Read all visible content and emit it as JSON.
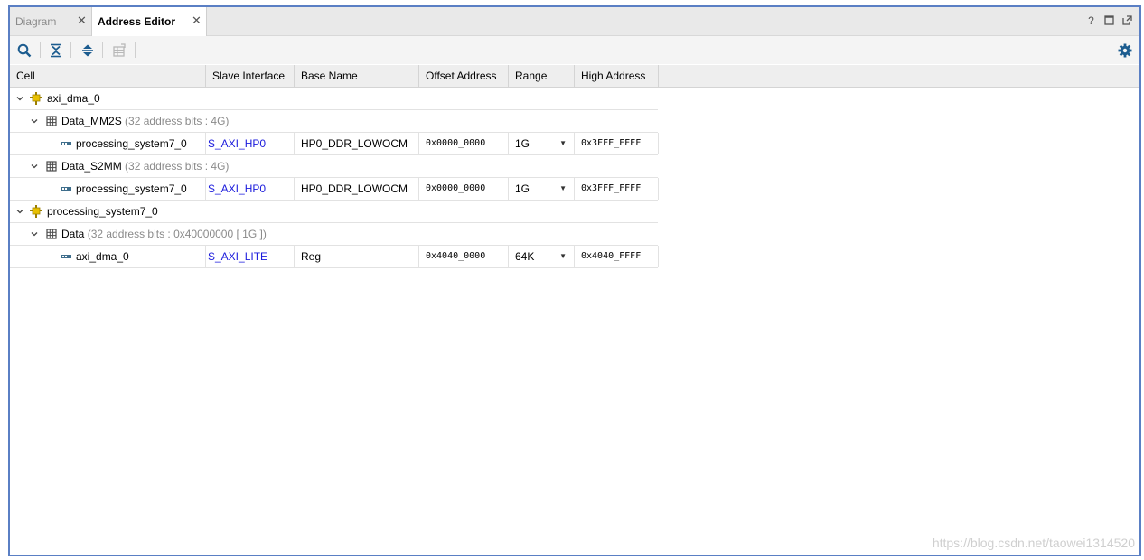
{
  "tabs": [
    {
      "label": "Diagram",
      "active": false
    },
    {
      "label": "Address Editor",
      "active": true
    }
  ],
  "window_icons": [
    "help-icon",
    "maximize-icon",
    "float-icon"
  ],
  "toolbar": {
    "buttons": [
      "search-icon",
      "collapse-all-icon",
      "expand-all-icon",
      "auto-assign-icon"
    ],
    "settings_icon": "gear-icon"
  },
  "columns": [
    "Cell",
    "Slave Interface",
    "Base Name",
    "Offset Address",
    "Range",
    "High Address"
  ],
  "rows": [
    {
      "level": 0,
      "type": "cell",
      "name": "axi_dma_0",
      "detail": ""
    },
    {
      "level": 1,
      "type": "space",
      "name": "Data_MM2S",
      "detail": "(32 address bits : 4G)"
    },
    {
      "level": 2,
      "type": "segment",
      "name": "processing_system7_0",
      "slave_interface": "S_AXI_HP0",
      "base_name": "HP0_DDR_LOWOCM",
      "offset": "0x0000_0000",
      "range": "1G",
      "high": "0x3FFF_FFFF"
    },
    {
      "level": 1,
      "type": "space",
      "name": "Data_S2MM",
      "detail": "(32 address bits : 4G)"
    },
    {
      "level": 2,
      "type": "segment",
      "name": "processing_system7_0",
      "slave_interface": "S_AXI_HP0",
      "base_name": "HP0_DDR_LOWOCM",
      "offset": "0x0000_0000",
      "range": "1G",
      "high": "0x3FFF_FFFF"
    },
    {
      "level": 0,
      "type": "cell",
      "name": "processing_system7_0",
      "detail": ""
    },
    {
      "level": 1,
      "type": "space",
      "name": "Data",
      "detail": "(32 address bits : 0x40000000 [ 1G ])"
    },
    {
      "level": 2,
      "type": "segment",
      "name": "axi_dma_0",
      "slave_interface": "S_AXI_LITE",
      "base_name": "Reg",
      "offset": "0x4040_0000",
      "range": "64K",
      "high": "0x4040_FFFF"
    }
  ],
  "watermark": "https://blog.csdn.net/taowei1314520",
  "colors": {
    "accent_border": "#5a7fc4",
    "link": "#1a1adc",
    "cell_icon": "#d4a900",
    "space_icon": "#4a4a4a"
  }
}
